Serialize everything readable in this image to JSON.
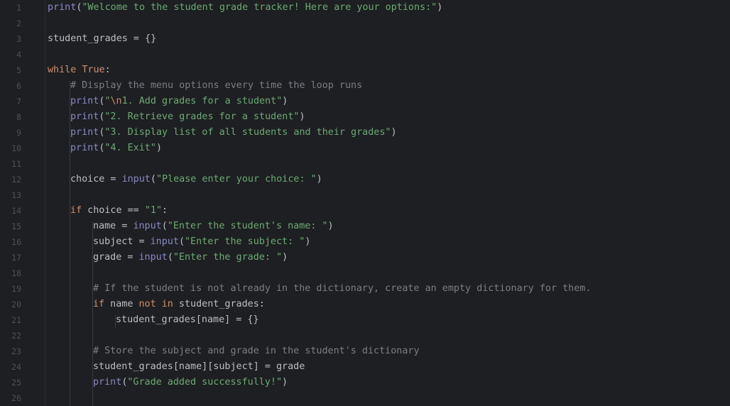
{
  "editor": {
    "language": "python",
    "colors": {
      "background": "#1e1f22",
      "keyword": "#cf8e6d",
      "builtin": "#8888c6",
      "string": "#6aab73",
      "comment": "#7a7e85",
      "text": "#bcbec4",
      "line_number": "#4b5059"
    },
    "lines": [
      {
        "num": "1",
        "indent": 0,
        "tokens": [
          {
            "t": "fn",
            "v": "print"
          },
          {
            "t": "tx",
            "v": "("
          },
          {
            "t": "str",
            "v": "\"Welcome to the student grade tracker! Here are your options:\""
          },
          {
            "t": "tx",
            "v": ")"
          }
        ]
      },
      {
        "num": "2",
        "indent": 0,
        "tokens": []
      },
      {
        "num": "3",
        "indent": 0,
        "tokens": [
          {
            "t": "tx",
            "v": "student_grades = {}"
          }
        ]
      },
      {
        "num": "4",
        "indent": 0,
        "tokens": []
      },
      {
        "num": "5",
        "indent": 0,
        "tokens": [
          {
            "t": "kw",
            "v": "while"
          },
          {
            "t": "tx",
            "v": " "
          },
          {
            "t": "kw",
            "v": "True"
          },
          {
            "t": "tx",
            "v": ":"
          }
        ]
      },
      {
        "num": "6",
        "indent": 1,
        "tokens": [
          {
            "t": "cm",
            "v": "# Display the menu options every time the loop runs"
          }
        ]
      },
      {
        "num": "7",
        "indent": 1,
        "tokens": [
          {
            "t": "fn",
            "v": "print"
          },
          {
            "t": "tx",
            "v": "("
          },
          {
            "t": "str",
            "v": "\""
          },
          {
            "t": "esc",
            "v": "\\n"
          },
          {
            "t": "str",
            "v": "1. Add grades for a student\""
          },
          {
            "t": "tx",
            "v": ")"
          }
        ]
      },
      {
        "num": "8",
        "indent": 1,
        "tokens": [
          {
            "t": "fn",
            "v": "print"
          },
          {
            "t": "tx",
            "v": "("
          },
          {
            "t": "str",
            "v": "\"2. Retrieve grades for a student\""
          },
          {
            "t": "tx",
            "v": ")"
          }
        ]
      },
      {
        "num": "9",
        "indent": 1,
        "tokens": [
          {
            "t": "fn",
            "v": "print"
          },
          {
            "t": "tx",
            "v": "("
          },
          {
            "t": "str",
            "v": "\"3. Display list of all students and their grades\""
          },
          {
            "t": "tx",
            "v": ")"
          }
        ]
      },
      {
        "num": "10",
        "indent": 1,
        "tokens": [
          {
            "t": "fn",
            "v": "print"
          },
          {
            "t": "tx",
            "v": "("
          },
          {
            "t": "str",
            "v": "\"4. Exit\""
          },
          {
            "t": "tx",
            "v": ")"
          }
        ]
      },
      {
        "num": "11",
        "indent": 1,
        "tokens": []
      },
      {
        "num": "12",
        "indent": 1,
        "tokens": [
          {
            "t": "tx",
            "v": "choice = "
          },
          {
            "t": "fn",
            "v": "input"
          },
          {
            "t": "tx",
            "v": "("
          },
          {
            "t": "str",
            "v": "\"Please enter your choice: \""
          },
          {
            "t": "tx",
            "v": ")"
          }
        ]
      },
      {
        "num": "13",
        "indent": 1,
        "tokens": []
      },
      {
        "num": "14",
        "indent": 1,
        "tokens": [
          {
            "t": "kw",
            "v": "if"
          },
          {
            "t": "tx",
            "v": " choice == "
          },
          {
            "t": "str",
            "v": "\"1\""
          },
          {
            "t": "tx",
            "v": ":"
          }
        ]
      },
      {
        "num": "15",
        "indent": 2,
        "tokens": [
          {
            "t": "tx",
            "v": "name = "
          },
          {
            "t": "fn",
            "v": "input"
          },
          {
            "t": "tx",
            "v": "("
          },
          {
            "t": "str",
            "v": "\"Enter the student's name: \""
          },
          {
            "t": "tx",
            "v": ")"
          }
        ]
      },
      {
        "num": "16",
        "indent": 2,
        "tokens": [
          {
            "t": "tx",
            "v": "subject = "
          },
          {
            "t": "fn",
            "v": "input"
          },
          {
            "t": "tx",
            "v": "("
          },
          {
            "t": "str",
            "v": "\"Enter the subject: \""
          },
          {
            "t": "tx",
            "v": ")"
          }
        ]
      },
      {
        "num": "17",
        "indent": 2,
        "tokens": [
          {
            "t": "tx",
            "v": "grade = "
          },
          {
            "t": "fn",
            "v": "input"
          },
          {
            "t": "tx",
            "v": "("
          },
          {
            "t": "str",
            "v": "\"Enter the grade: \""
          },
          {
            "t": "tx",
            "v": ")"
          }
        ]
      },
      {
        "num": "18",
        "indent": 2,
        "tokens": []
      },
      {
        "num": "19",
        "indent": 2,
        "tokens": [
          {
            "t": "cm",
            "v": "# If the student is not already in the dictionary, create an empty dictionary for them."
          }
        ]
      },
      {
        "num": "20",
        "indent": 2,
        "tokens": [
          {
            "t": "kw",
            "v": "if"
          },
          {
            "t": "tx",
            "v": " name "
          },
          {
            "t": "kw",
            "v": "not in"
          },
          {
            "t": "tx",
            "v": " student_grades:"
          }
        ]
      },
      {
        "num": "21",
        "indent": 3,
        "tokens": [
          {
            "t": "tx",
            "v": "student_grades[name] = {}"
          }
        ]
      },
      {
        "num": "22",
        "indent": 2,
        "tokens": []
      },
      {
        "num": "23",
        "indent": 2,
        "tokens": [
          {
            "t": "cm",
            "v": "# Store the subject and grade in the student's dictionary"
          }
        ]
      },
      {
        "num": "24",
        "indent": 2,
        "tokens": [
          {
            "t": "tx",
            "v": "student_grades[name][subject] = grade"
          }
        ]
      },
      {
        "num": "25",
        "indent": 2,
        "tokens": [
          {
            "t": "fn",
            "v": "print"
          },
          {
            "t": "tx",
            "v": "("
          },
          {
            "t": "str",
            "v": "\"Grade added successfully!\""
          },
          {
            "t": "tx",
            "v": ")"
          }
        ]
      },
      {
        "num": "26",
        "indent": 2,
        "tokens": []
      }
    ]
  }
}
